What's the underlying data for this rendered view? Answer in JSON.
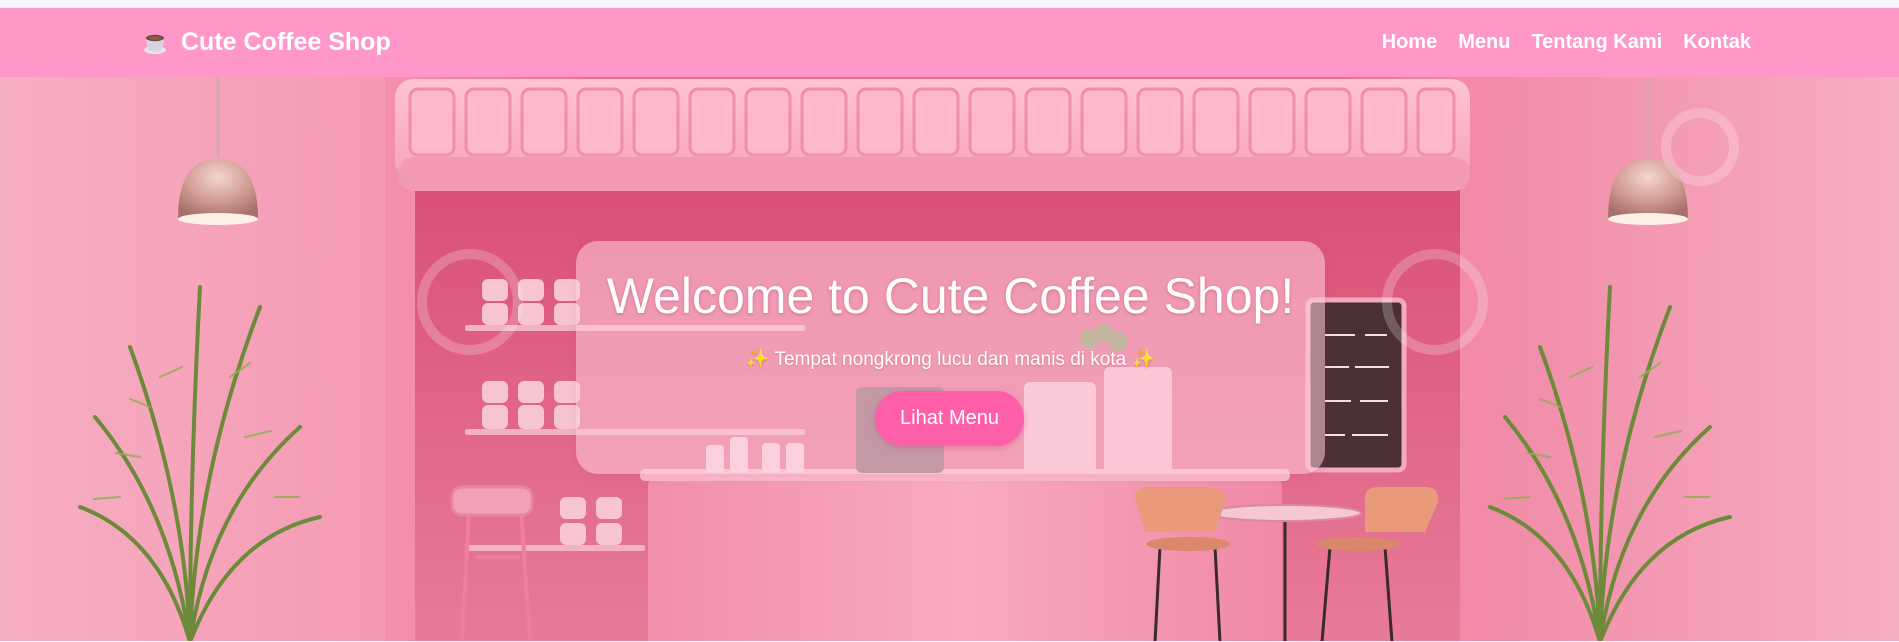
{
  "navbar": {
    "brand_icon": "coffee-cup-icon",
    "brand_title": "Cute Coffee Shop",
    "links": [
      {
        "label": "Home"
      },
      {
        "label": "Menu"
      },
      {
        "label": "Tentang Kami"
      },
      {
        "label": "Kontak"
      }
    ]
  },
  "hero": {
    "title": "Welcome to Cute Coffee Shop!",
    "sparkle_icon": "sparkles-icon",
    "sparkle_glyph": "✨",
    "subtitle": "Tempat nongkrong lucu dan manis di kota",
    "cta_label": "Lihat Menu"
  },
  "colors": {
    "navbar_bg": "#ff97c8",
    "cta_bg": "#ff5fa8",
    "hero_pink": "#e96d90",
    "text": "#ffffff"
  }
}
